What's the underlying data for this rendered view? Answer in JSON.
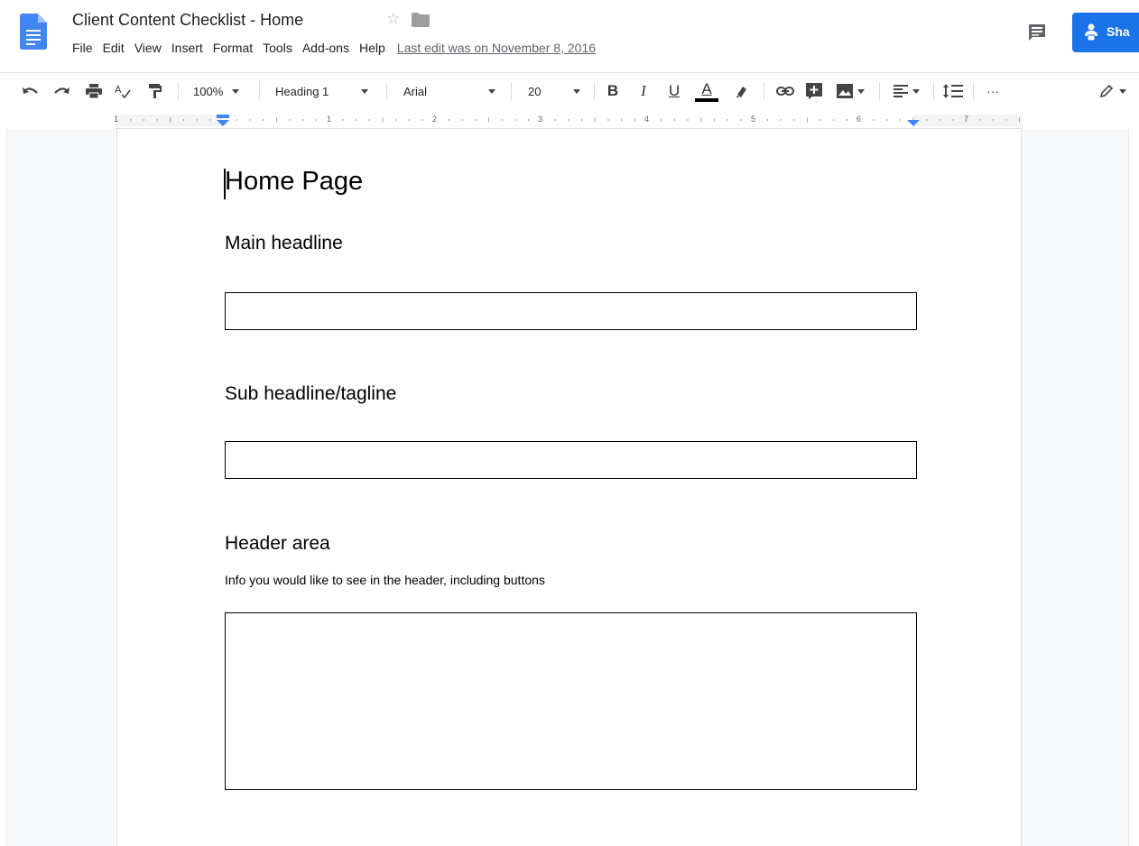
{
  "titlebar": {
    "doc_title": "Client Content Checklist - Home",
    "star": "☆",
    "last_edit": "Last edit was on November 8, 2016",
    "share_label": "Sha"
  },
  "menu": [
    "File",
    "Edit",
    "View",
    "Insert",
    "Format",
    "Tools",
    "Add-ons",
    "Help"
  ],
  "toolbar": {
    "zoom": "100%",
    "style": "Heading 1",
    "font": "Arial",
    "font_size": "20",
    "bold": "B",
    "italic": "I",
    "underline": "U",
    "text_color_letter": "A",
    "more": "···"
  },
  "ruler": {
    "numbers": [
      "1",
      "1",
      "2",
      "3",
      "4",
      "5",
      "6",
      "7"
    ]
  },
  "document": {
    "title": "Home Page",
    "sections": [
      {
        "heading": "Main headline"
      },
      {
        "heading": "Sub headline/tagline"
      },
      {
        "heading": "Header area",
        "description": "Info you would like to see in the header, including buttons"
      }
    ]
  },
  "colors": {
    "accent": "#1a73e8",
    "doc_icon": "#4285f4",
    "ruler_indent": "#4285f4"
  }
}
